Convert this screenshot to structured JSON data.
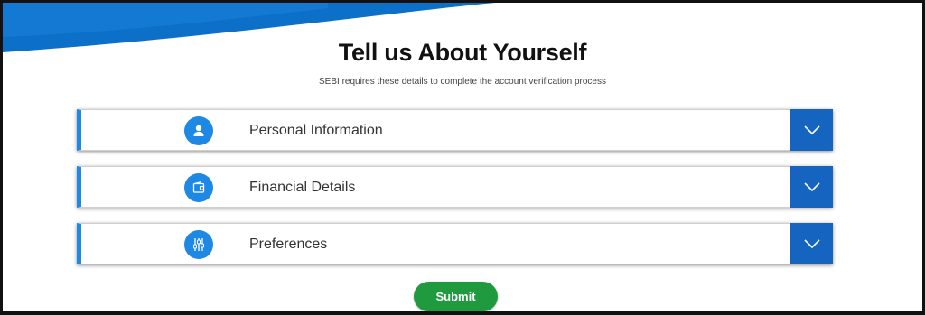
{
  "page": {
    "title": "Tell us About Yourself",
    "subtitle": "SEBI requires these details to complete the account verification process"
  },
  "sections": [
    {
      "label": "Personal Information",
      "icon": "person-icon"
    },
    {
      "label": "Financial Details",
      "icon": "wallet-icon"
    },
    {
      "label": "Preferences",
      "icon": "sliders-icon"
    }
  ],
  "submit": {
    "label": "Submit"
  },
  "colors": {
    "accent": "#1e88e5",
    "toggle": "#1565c0",
    "submit": "#1f9a3e",
    "banner": "#0d70c8"
  }
}
